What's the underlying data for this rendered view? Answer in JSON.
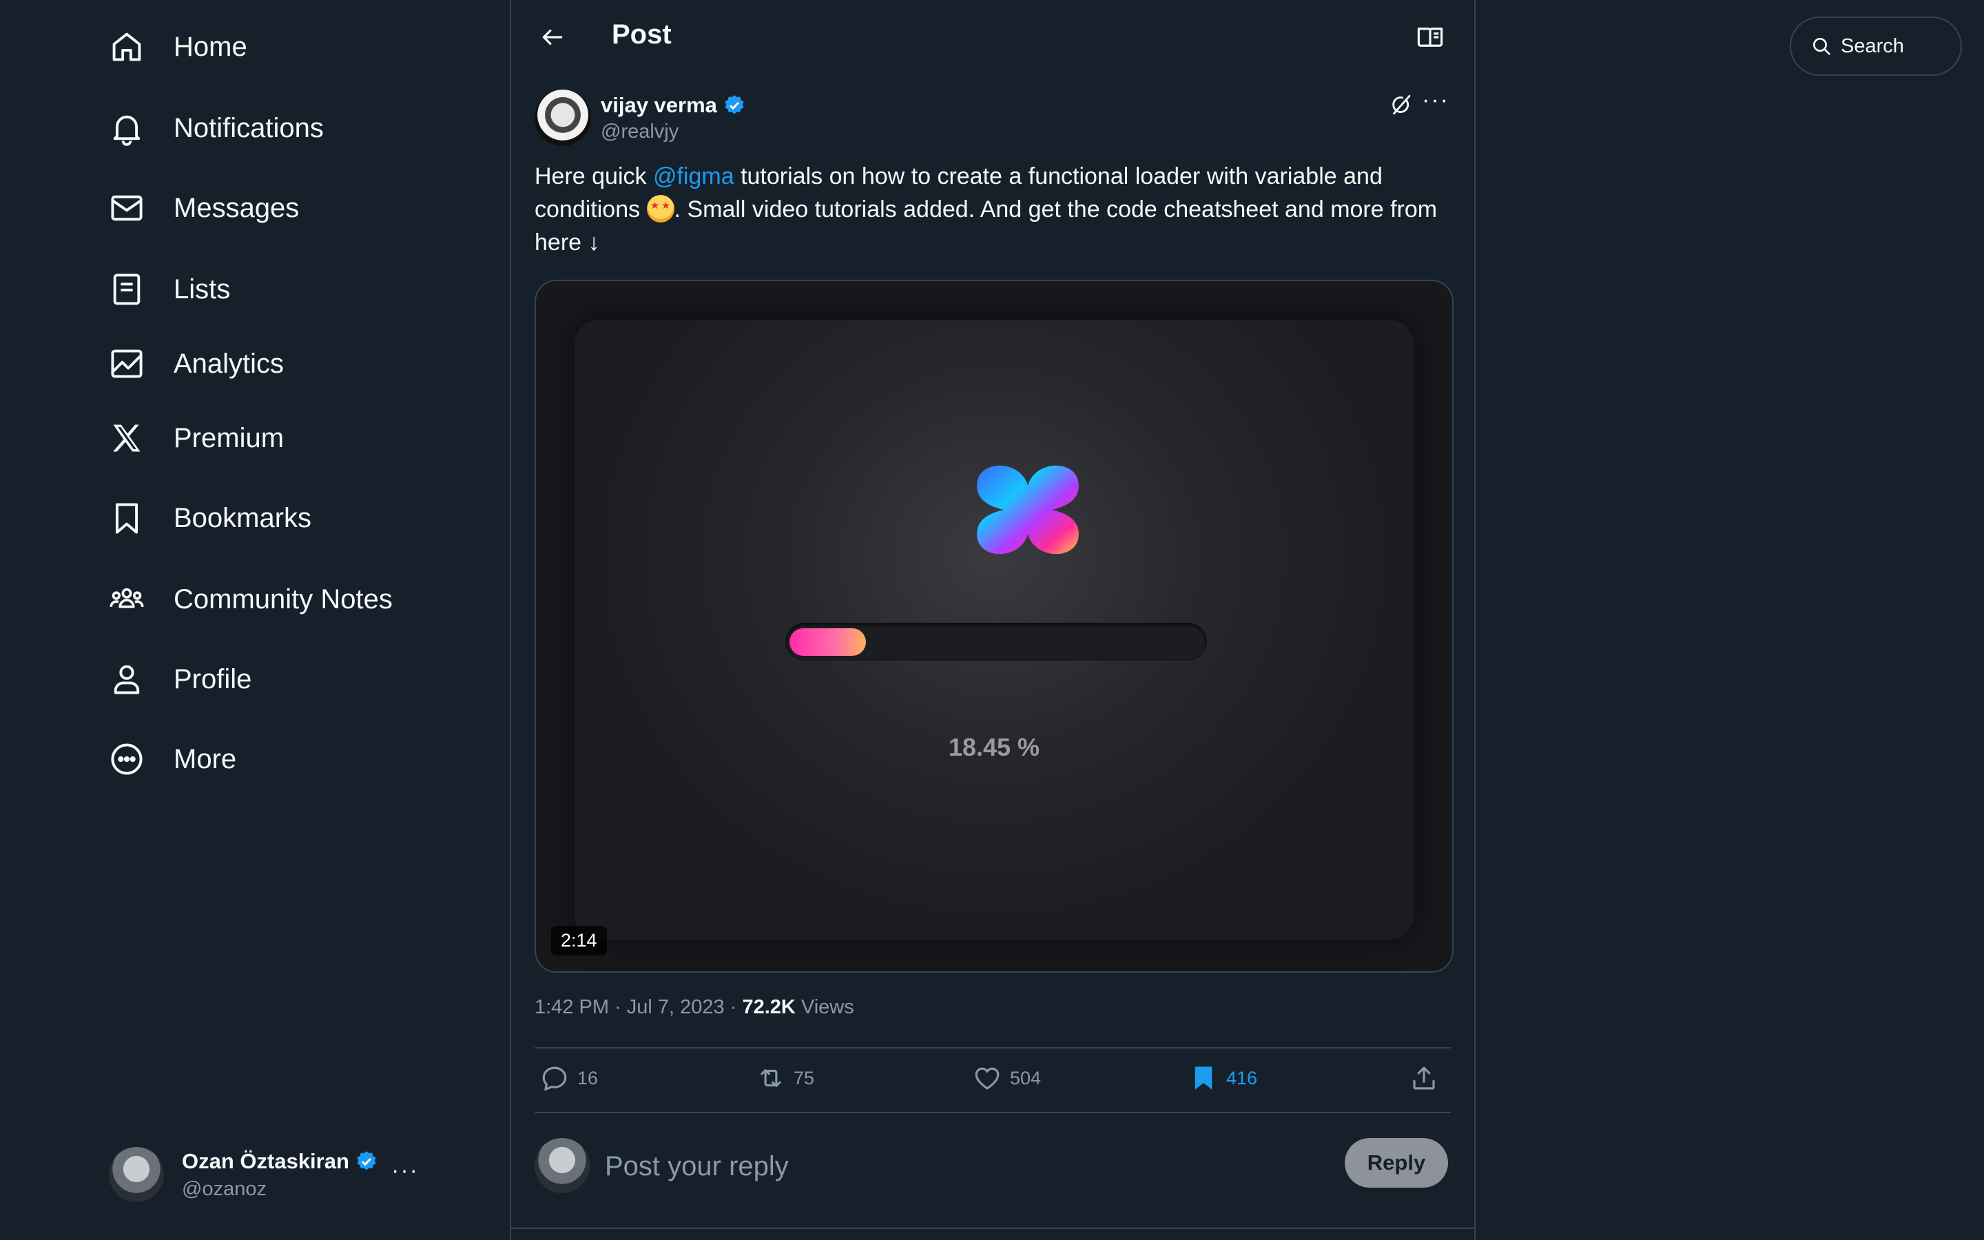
{
  "sidebar": {
    "items": [
      {
        "label": "Home",
        "icon": "home-icon"
      },
      {
        "label": "Notifications",
        "icon": "bell-icon"
      },
      {
        "label": "Messages",
        "icon": "envelope-icon"
      },
      {
        "label": "Lists",
        "icon": "list-icon"
      },
      {
        "label": "Analytics",
        "icon": "analytics-icon"
      },
      {
        "label": "Premium",
        "icon": "x-logo-icon"
      },
      {
        "label": "Bookmarks",
        "icon": "bookmark-icon"
      },
      {
        "label": "Community Notes",
        "icon": "community-icon"
      },
      {
        "label": "Profile",
        "icon": "person-icon"
      },
      {
        "label": "More",
        "icon": "more-circle-icon"
      }
    ],
    "account": {
      "display_name": "Ozan Öztaskiran",
      "handle": "@ozanoz",
      "more": "···"
    }
  },
  "header": {
    "title": "Post"
  },
  "post": {
    "author": {
      "display_name": "vijay verma",
      "handle": "@realvjy"
    },
    "more": "···",
    "text_before": "Here quick ",
    "mention": "@figma",
    "text_mid": " tutorials on how to create a functional loader with variable and conditions ",
    "text_after": ". Small video tutorials added. And get the code cheatsheet and more from here ↓",
    "media": {
      "loader_percent_text": "18.45 %",
      "loader_progress": 0.1845,
      "duration": "2:14"
    },
    "meta": {
      "time_date": "1:42 PM · Jul 7, 2023 · ",
      "views_count": "72.2K",
      "views_label": " Views"
    },
    "actions": {
      "replies": "16",
      "reposts": "75",
      "likes": "504",
      "bookmarks": "416"
    }
  },
  "reply": {
    "placeholder": "Post your reply",
    "button": "Reply"
  },
  "search": {
    "placeholder": "Search"
  },
  "colors": {
    "background": "#15202b",
    "accent": "#1d9bf0",
    "border": "#38444d",
    "muted_text": "#8b98a5"
  }
}
